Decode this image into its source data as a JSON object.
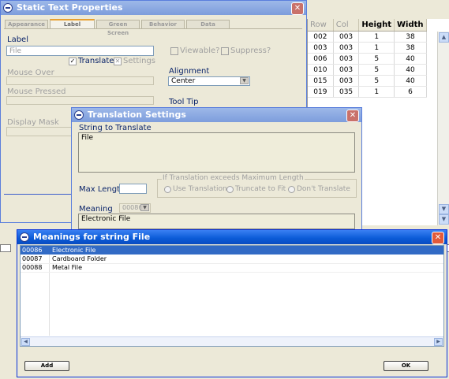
{
  "grid": {
    "headers": [
      "Row",
      "Col",
      "Height",
      "Width"
    ],
    "rows": [
      [
        "002",
        "003",
        "1",
        "38"
      ],
      [
        "003",
        "003",
        "1",
        "38"
      ],
      [
        "006",
        "003",
        "5",
        "40"
      ],
      [
        "010",
        "003",
        "5",
        "40"
      ],
      [
        "015",
        "003",
        "5",
        "40"
      ],
      [
        "019",
        "035",
        "1",
        "6"
      ]
    ],
    "scroll_up": "▲",
    "scroll_down": "▼"
  },
  "static": {
    "title": "Static Text Properties",
    "close": "✕",
    "tabs": [
      "Appearance",
      "Label",
      "Green Screen",
      "Behavior",
      "Data"
    ],
    "label_caption": "Label",
    "label_value": "File",
    "translate_label": "Translate?",
    "translate_check": "✓",
    "settings_label": "Settings",
    "settings_check": "✕",
    "viewable_label": "Viewable?",
    "suppress_label": "Suppress?",
    "mouse_over": "Mouse Over",
    "mouse_pressed": "Mouse Pressed",
    "display_mask": "Display Mask",
    "alignment_label": "Alignment",
    "alignment_value": "Center",
    "tooltip_label": "Tool Tip"
  },
  "translation": {
    "title": "Translation Settings",
    "close": "✕",
    "string_label": "String to Translate",
    "string_value": "File",
    "max_length_label": "Max Length",
    "max_length_value": "",
    "exceeds_label": "If Translation exceeds Maximum Length",
    "opt_use": "Use Translation",
    "opt_truncate": "Truncate to Fit",
    "opt_dont": "Don't Translate",
    "meaning_label": "Meaning",
    "meaning_code": "00086",
    "meaning_value": "Electronic File"
  },
  "meanings": {
    "title": "Meanings for string File",
    "close": "✕",
    "items": [
      {
        "code": "00086",
        "text": "Electronic File"
      },
      {
        "code": "00087",
        "text": "Cardboard Folder"
      },
      {
        "code": "00088",
        "text": "Metal File"
      }
    ],
    "add_label": "Add",
    "ok_label": "OK"
  }
}
